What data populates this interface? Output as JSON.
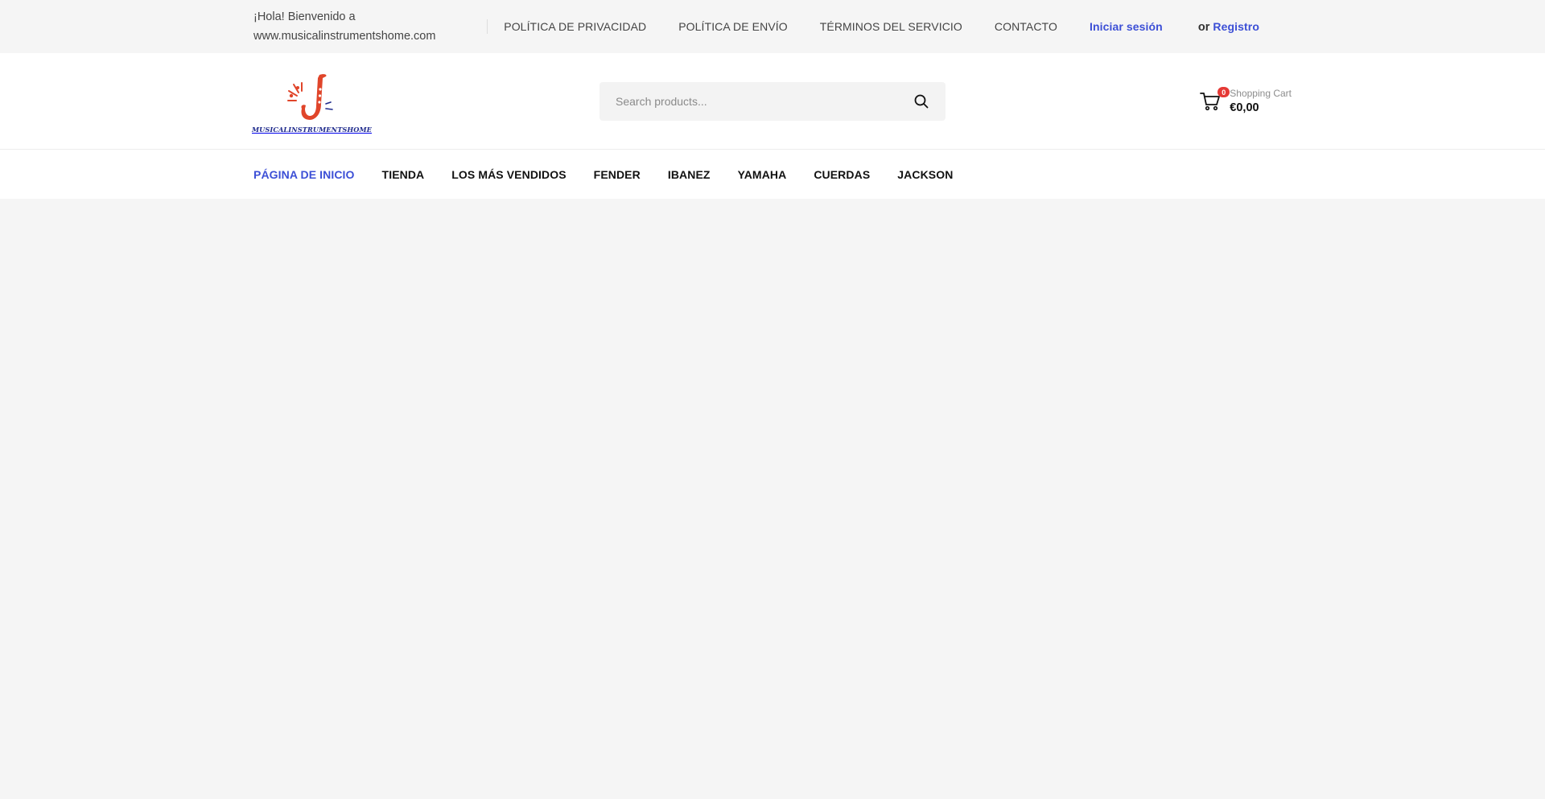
{
  "topbar": {
    "welcome_line1": "¡Hola! Bienvenido a",
    "welcome_line2": "www.musicalinstrumentshome.com",
    "links": [
      "POLÍTICA DE PRIVACIDAD",
      "POLÍTICA DE ENVÍO",
      "TÉRMINOS DEL SERVICIO",
      "CONTACTO"
    ],
    "login_label": "Iniciar sesión",
    "or_label": "or",
    "register_label": "Registro"
  },
  "header": {
    "logo_text": "MUSICALINSTRUMENTSHOME",
    "search_placeholder": "Search products...",
    "search_icon": "search-icon",
    "cart_icon": "shopping-cart-icon",
    "cart_count": "0",
    "cart_label": "Shopping Cart",
    "cart_total": "€0,00"
  },
  "nav": {
    "items": [
      "PÁGINA DE INICIO",
      "TIENDA",
      "LOS MÁS VENDIDOS",
      "FENDER",
      "IBANEZ",
      "YAMAHA",
      "CUERDAS",
      "JACKSON"
    ],
    "active_index": 0
  },
  "colors": {
    "accent": "#3c4fd6",
    "badge": "#e53935",
    "logo_red": "#e0452a",
    "logo_blue": "#1e2a8c"
  }
}
